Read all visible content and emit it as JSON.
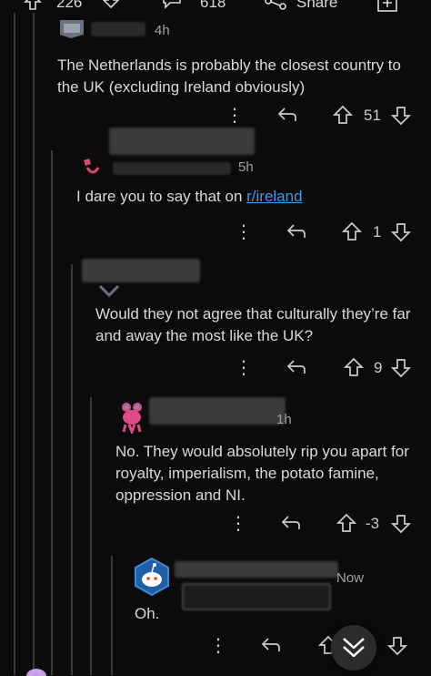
{
  "post_bar": {
    "upvotes": "226",
    "comments": "618",
    "share_label": "Share"
  },
  "comments": [
    {
      "time": "4h",
      "text": "The Netherlands is probably the closest country to the UK (excluding Ireland obviously)",
      "score": "51"
    },
    {
      "time": "5h",
      "text_prefix": "I dare you to say that on ",
      "link_text": "r/ireland",
      "score": "1"
    },
    {
      "text": "Would they not agree that culturally they’re far and away the most like the UK?",
      "score": "9"
    },
    {
      "time": "1h",
      "text": "No. They would absolutely rip you apart for royalty, imperialism, the potato famine, oppression and NI.",
      "score": "-3"
    },
    {
      "time": "Now",
      "text": "Oh."
    }
  ],
  "colors": {
    "background": "#0b0b0b",
    "text": "#d7dadc",
    "link": "#3d9be9",
    "thread_line": "#3a3a3a"
  },
  "icons": [
    "upvote-icon",
    "downvote-icon",
    "comment-icon",
    "share-icon",
    "award-icon",
    "more-icon",
    "reply-icon",
    "scroll-down-icon",
    "avatar-icon"
  ]
}
